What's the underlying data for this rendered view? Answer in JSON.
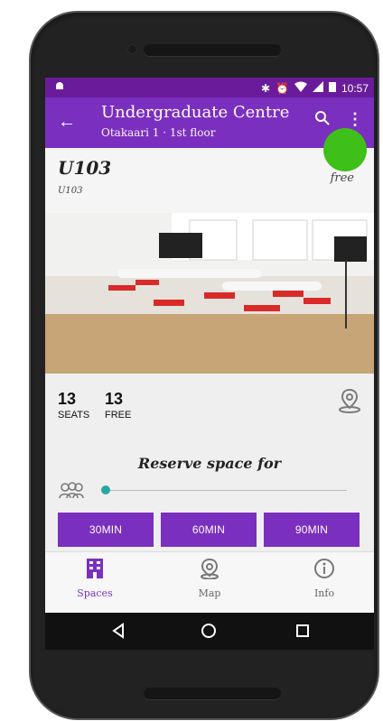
{
  "statusbar": {
    "time": "10:57"
  },
  "appbar": {
    "title": "Undergraduate Centre",
    "subtitle": "Otakaari 1 · 1st floor"
  },
  "room": {
    "title": "U103",
    "subtitle": "U103",
    "status": "free"
  },
  "stats": {
    "seats_value": "13",
    "seats_label": "SEATS",
    "free_value": "13",
    "free_label": "FREE"
  },
  "reserve": {
    "title": "Reserve space for",
    "buttons": [
      "30MIN",
      "60MIN",
      "90MIN"
    ]
  },
  "bottom_nav": {
    "items": [
      {
        "label": "Spaces",
        "active": true
      },
      {
        "label": "Map",
        "active": false
      },
      {
        "label": "Info",
        "active": false
      }
    ]
  },
  "colors": {
    "primary": "#7b2fbf",
    "status_free": "#3fbf19",
    "slider": "#2aa7a0"
  }
}
